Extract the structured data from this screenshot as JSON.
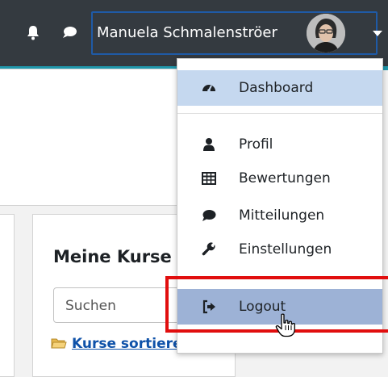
{
  "navbar": {
    "user_name": "Manuela Schmalenströer",
    "icons": [
      "bell-icon",
      "chat-icon",
      "avatar",
      "chevron-down-icon"
    ]
  },
  "user_menu": {
    "items": [
      {
        "label": "Dashboard",
        "icon": "dashboard-icon"
      },
      {
        "label": "Profil",
        "icon": "user-icon"
      },
      {
        "label": "Bewertungen",
        "icon": "table-icon"
      },
      {
        "label": "Mitteilungen",
        "icon": "comment-icon"
      },
      {
        "label": "Einstellungen",
        "icon": "wrench-icon"
      },
      {
        "label": "Logout",
        "icon": "sign-out-icon"
      }
    ]
  },
  "main": {
    "card_title": "Meine Kurse",
    "search_placeholder": "Suchen",
    "sort_link": "Kurse sortieren..."
  },
  "colors": {
    "navbar_bg": "#343a40",
    "accent_strip": "#1f97ab",
    "active_item_bg": "#c5d8ef",
    "hover_item_bg": "#9db2d6",
    "highlight_border": "#e10e0e",
    "link": "#0f52a9"
  }
}
